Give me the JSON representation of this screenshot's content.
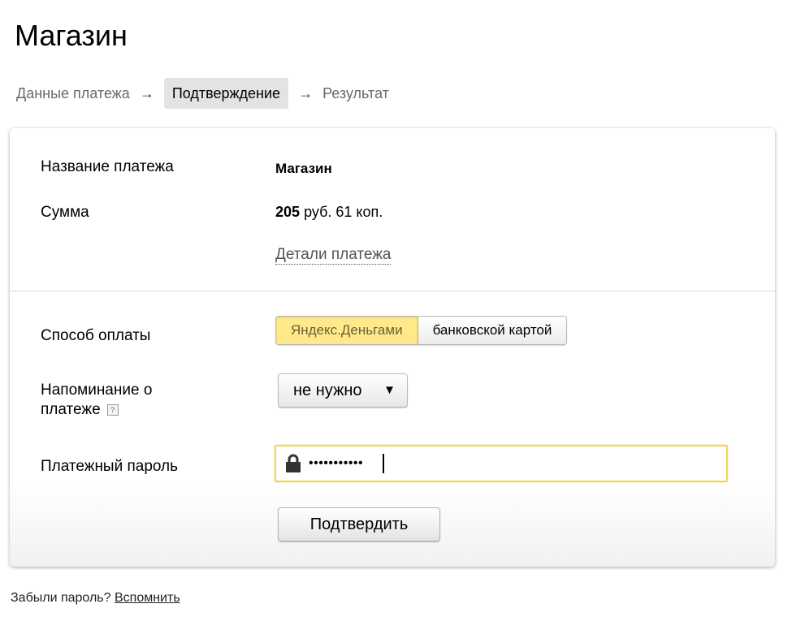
{
  "page": {
    "title": "Магазин"
  },
  "steps": [
    {
      "label": "Данные платежа"
    },
    {
      "label": "Подтверждение"
    },
    {
      "label": "Результат"
    }
  ],
  "steps_arrow": "→",
  "summary": {
    "name_label": "Название платежа",
    "name_value": "Магазин",
    "amount_label": "Сумма",
    "amount_rub": "205",
    "amount_rest": "руб. 61 коп.",
    "details_link": "Детали платежа"
  },
  "payment": {
    "method_label": "Способ оплаты",
    "method_options": [
      "Яндекс.Деньгами",
      "банковской картой"
    ],
    "method_selected": "Яндекс.Деньгами",
    "reminder_label_line1": "Напоминание о",
    "reminder_label_line2": "платеже",
    "reminder_help": "?",
    "reminder_value": "не нужно",
    "reminder_arrow": "▼",
    "password_label": "Платежный пароль",
    "password_value": "•••••••••••",
    "confirm_button": "Подтвердить"
  },
  "footer": {
    "forgot_text": "Забыли пароль?",
    "forgot_link": "Вспомнить"
  },
  "icons": {
    "lock": "lock-icon",
    "help": "help-icon",
    "dropdown": "chevron-down-icon"
  },
  "colors": {
    "accent": "#ffe98a",
    "focus_border": "#f2d755",
    "active_step_bg": "#e3e3e3"
  }
}
